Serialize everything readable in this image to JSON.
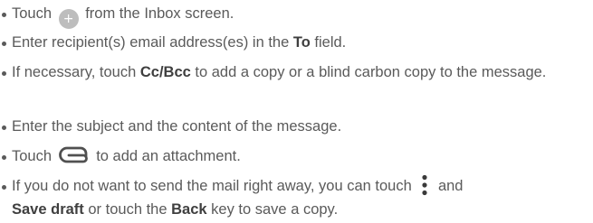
{
  "steps": [
    {
      "before": "Touch ",
      "icon": "plus-icon",
      "icon_glyph": "+",
      "after": " from the Inbox screen."
    },
    {
      "before": "Enter recipient(s) email address(es) in the ",
      "term": "To",
      "after": " field."
    },
    {
      "before": "If necessary, touch ",
      "term": "Cc/Bcc",
      "after": " to add a copy or a blind carbon copy to the message."
    },
    {
      "text": "Enter the subject and the content of the message."
    },
    {
      "before": "Touch ",
      "icon": "paperclip-icon",
      "after": " to add an attachment."
    },
    {
      "before": "If you do not want to send the mail right away, you can touch ",
      "icon": "more-vertical-icon",
      "middle": " and ",
      "term": "Save draft",
      "middle2": " or touch the ",
      "term2": "Back",
      "after": " key to save a copy."
    }
  ],
  "colors": {
    "text": "#5a5a5a",
    "bold_text": "#3f3f3f",
    "icon_fill": "#bdbdbd",
    "icon_stroke": "#505050"
  }
}
